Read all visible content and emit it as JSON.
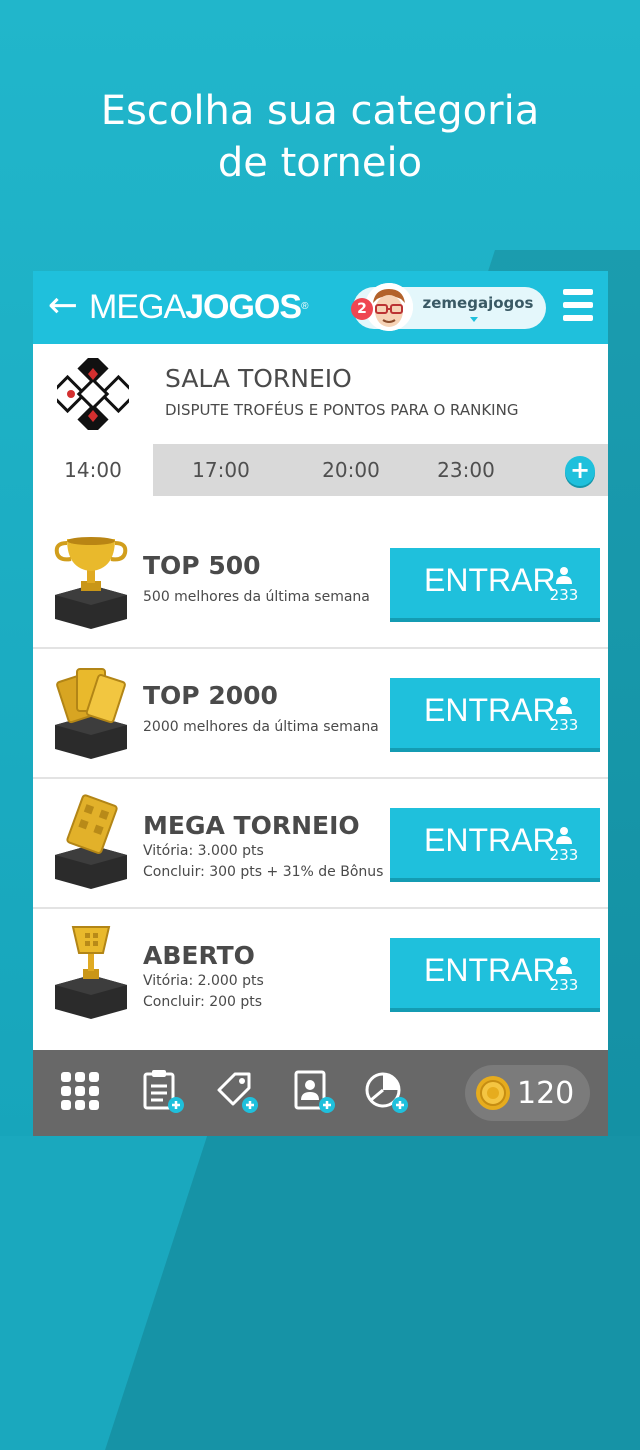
{
  "headline": {
    "line1": "Escolha sua categoria",
    "line2": "de torneio"
  },
  "appbar": {
    "back_label": "←",
    "logo_part1": "MEGA",
    "logo_part2": "JOGOS",
    "logo_reg": "®",
    "username": "zemegajogos",
    "notifications": "2"
  },
  "room": {
    "title": "SALA TORNEIO",
    "subtitle": "DISPUTE TROFÉUS E PONTOS PARA O RANKING"
  },
  "tabs": {
    "times": [
      "14:00",
      "17:00",
      "20:00",
      "23:00"
    ],
    "active_index": 0,
    "add_label": "+"
  },
  "tournaments": [
    {
      "title": "TOP 500",
      "desc1": "500 melhores da última semana",
      "desc2": "",
      "button": "ENTRAR",
      "players": "233"
    },
    {
      "title": "TOP 2000",
      "desc1": "2000 melhores da última semana",
      "desc2": "",
      "button": "ENTRAR",
      "players": "233"
    },
    {
      "title": "MEGA TORNEIO",
      "desc1": "Vitória: 3.000 pts",
      "desc2": "Concluir: 300 pts  +  31% de Bônus",
      "button": "ENTRAR",
      "players": "233"
    },
    {
      "title": "ABERTO",
      "desc1": "Vitória: 2.000 pts",
      "desc2": "Concluir: 200 pts",
      "button": "ENTRAR",
      "players": "233"
    }
  ],
  "bottombar": {
    "items": [
      "grid-icon",
      "clipboard-add-icon",
      "tag-add-icon",
      "profile-card-add-icon",
      "pie-chart-add-icon"
    ],
    "coins": "120"
  },
  "colors": {
    "accent": "#1fc0dc",
    "background": "#1aa8be",
    "bottombar": "#686868",
    "badge": "#ef4651"
  }
}
